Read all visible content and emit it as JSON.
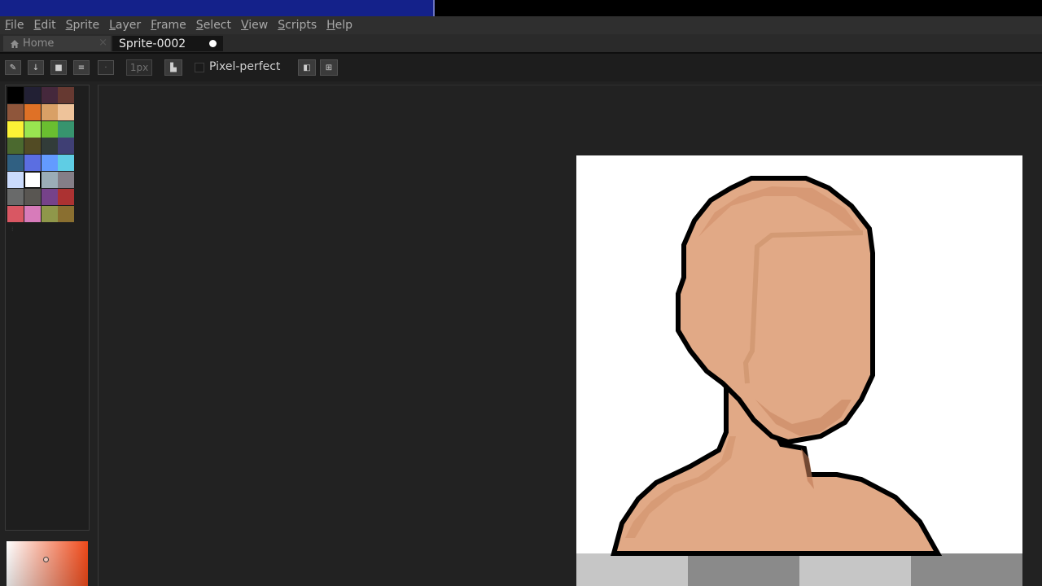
{
  "menubar": {
    "items": [
      "File",
      "Edit",
      "Sprite",
      "Layer",
      "Frame",
      "Select",
      "View",
      "Scripts",
      "Help"
    ]
  },
  "tabs": {
    "home_label": "Home",
    "close_glyph": "×",
    "active_label": "Sprite-0002"
  },
  "toolbar": {
    "brush_size": "1px",
    "pixel_perfect_label": "Pixel-perfect",
    "icons": [
      "pencil-icon",
      "arrow-down-icon",
      "square-icon",
      "menu-icon",
      "brush-type-icon",
      "ink-icon",
      "symmetry-icon",
      "symmetry-mode-icon"
    ]
  },
  "palette": {
    "colors": [
      "#000000",
      "#222034",
      "#45283c",
      "#663931",
      "#8f563b",
      "#df7126",
      "#d9a066",
      "#eec39a",
      "#fbf236",
      "#99e550",
      "#6abe30",
      "#37946e",
      "#4b692f",
      "#524b24",
      "#323c39",
      "#3f3f74",
      "#306082",
      "#5b6ee1",
      "#639bff",
      "#5fcde4",
      "#cbdbfc",
      "#ffffff",
      "#9badb7",
      "#847e87",
      "#696a6a",
      "#595652",
      "#76428a",
      "#ac3232",
      "#d95763",
      "#d77bba",
      "#8f974a",
      "#8a6f30"
    ],
    "selected_index": 21
  },
  "color_picker": {
    "hue_color": "#f04a1a"
  },
  "colors": {
    "title_bar": "#14218a",
    "background": "#222222",
    "skin": "#e1a986",
    "skin_shadow": "#d0906a",
    "outline": "#000000"
  }
}
